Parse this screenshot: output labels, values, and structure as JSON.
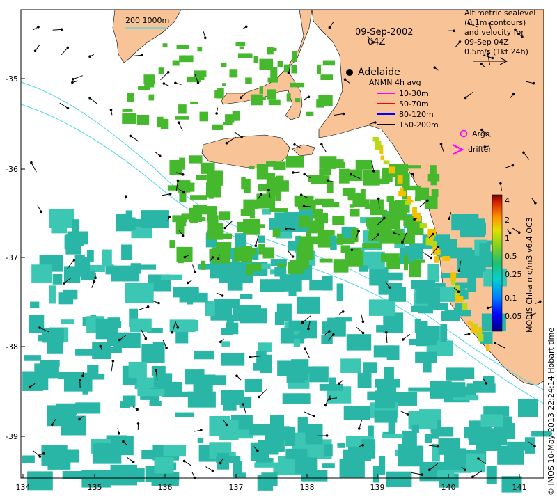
{
  "map": {
    "date_title": "09-Sep-2002",
    "time_title": "04Z",
    "scale_label": "200  1000m",
    "city_label": "Adelaide",
    "top_right_note": [
      "Altimetric sealevel",
      "(0.1m contours)",
      "and velocity for",
      "09-Sep 04Z",
      "0.5m/s (1kt 24h)"
    ],
    "anmn_title": "ANMN 4h avg",
    "anmn_legend": [
      {
        "label": "10-30m",
        "color": "#ff00ff"
      },
      {
        "label": "50-70m",
        "color": "#ff0000"
      },
      {
        "label": "80-120m",
        "color": "#0000ff"
      },
      {
        "label": "150-200m",
        "color": "#000000"
      }
    ],
    "argo_label": "Argo",
    "drifter_label": "drifter",
    "colorbar_label": "MODIS Chl-a mg/m3 v6.4 OC3",
    "colorbar_ticks": [
      "4",
      "2",
      "1",
      "0.5",
      "0.25",
      "0.1",
      "0.05"
    ],
    "credit": "© IMOS 10-May-2013 22:24:14 Hobart time",
    "x_ticks": [
      "134",
      "135",
      "136",
      "137",
      "138",
      "139",
      "140",
      "141"
    ],
    "y_ticks": [
      "-35",
      "-36",
      "-37",
      "-38",
      "-39"
    ],
    "colors": {
      "land": "#f7c397",
      "isobath": "#4fd6e6",
      "chl_low": "#2ab6a6",
      "chl_mid": "#46b82d",
      "chl_high": "#f2c200"
    }
  }
}
